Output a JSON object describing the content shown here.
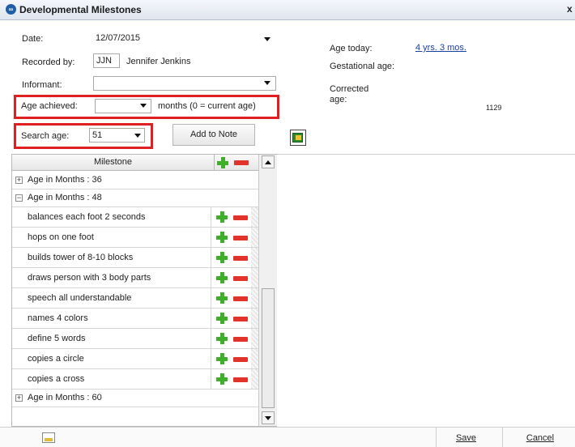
{
  "window": {
    "title": "Developmental Milestones",
    "icon": "app-logo-icon",
    "close_glyph": "x"
  },
  "form": {
    "date_label": "Date:",
    "date_value": "12/07/2015",
    "recorded_by_label": "Recorded by:",
    "recorded_by_initials": "JJN",
    "recorded_by_name": "Jennifer Jenkins",
    "informant_label": "Informant:",
    "informant_value": "",
    "age_achieved_label": "Age achieved:",
    "age_achieved_value": "",
    "age_achieved_hint": "months (0 = current age)",
    "search_age_label": "Search age:",
    "search_age_value": "51",
    "add_to_note_label": "Add to Note"
  },
  "info": {
    "age_today_label": "Age today:",
    "age_today_value": "4 yrs. 3 mos.",
    "gestational_age_label": "Gestational age:",
    "corrected_age_label_1": "Corrected",
    "corrected_age_label_2": "age:",
    "corrected_age_value": "1129"
  },
  "grid": {
    "header": "Milestone",
    "groups": [
      {
        "label": "Age in Months : 36",
        "expander": "+"
      },
      {
        "label": "Age in Months : 48",
        "expander": "−"
      },
      {
        "label": "Age in Months : 60",
        "expander": "+"
      }
    ],
    "items": [
      "balances each foot 2 seconds",
      "hops on one foot",
      "builds tower of 8-10 blocks",
      "draws person with 3 body parts",
      "speech all understandable",
      "names 4 colors",
      "define 5 words",
      "copies a circle",
      "copies a cross"
    ]
  },
  "footer": {
    "save_label": "Save",
    "cancel_label": "Cancel"
  },
  "colors": {
    "highlight_box": "#e02020",
    "plus": "#3fae2a",
    "minus": "#e2332b",
    "link": "#1a3fa0"
  }
}
